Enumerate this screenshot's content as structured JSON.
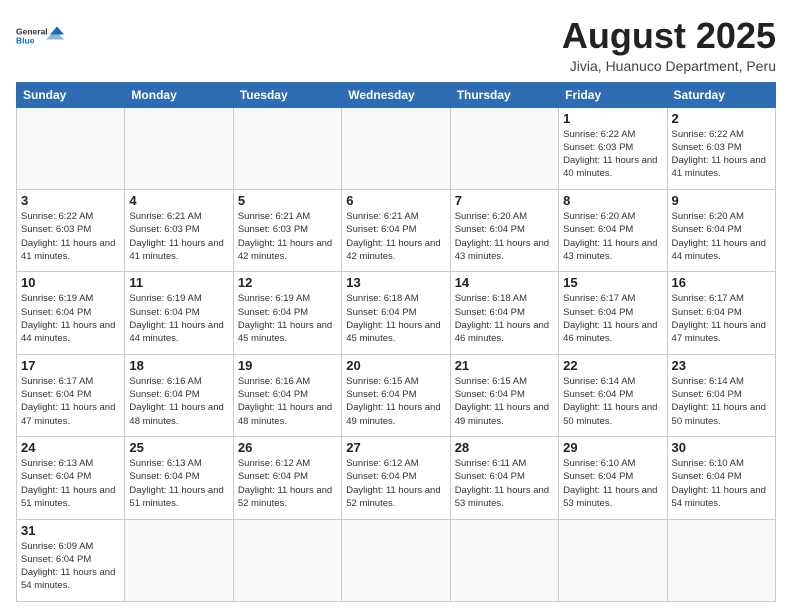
{
  "header": {
    "logo_general": "General",
    "logo_blue": "Blue",
    "title": "August 2025",
    "subtitle": "Jivia, Huanuco Department, Peru"
  },
  "calendar": {
    "days_of_week": [
      "Sunday",
      "Monday",
      "Tuesday",
      "Wednesday",
      "Thursday",
      "Friday",
      "Saturday"
    ],
    "weeks": [
      [
        {
          "day": "",
          "info": ""
        },
        {
          "day": "",
          "info": ""
        },
        {
          "day": "",
          "info": ""
        },
        {
          "day": "",
          "info": ""
        },
        {
          "day": "",
          "info": ""
        },
        {
          "day": "1",
          "info": "Sunrise: 6:22 AM\nSunset: 6:03 PM\nDaylight: 11 hours\nand 40 minutes."
        },
        {
          "day": "2",
          "info": "Sunrise: 6:22 AM\nSunset: 6:03 PM\nDaylight: 11 hours\nand 41 minutes."
        }
      ],
      [
        {
          "day": "3",
          "info": "Sunrise: 6:22 AM\nSunset: 6:03 PM\nDaylight: 11 hours\nand 41 minutes."
        },
        {
          "day": "4",
          "info": "Sunrise: 6:21 AM\nSunset: 6:03 PM\nDaylight: 11 hours\nand 41 minutes."
        },
        {
          "day": "5",
          "info": "Sunrise: 6:21 AM\nSunset: 6:03 PM\nDaylight: 11 hours\nand 42 minutes."
        },
        {
          "day": "6",
          "info": "Sunrise: 6:21 AM\nSunset: 6:04 PM\nDaylight: 11 hours\nand 42 minutes."
        },
        {
          "day": "7",
          "info": "Sunrise: 6:20 AM\nSunset: 6:04 PM\nDaylight: 11 hours\nand 43 minutes."
        },
        {
          "day": "8",
          "info": "Sunrise: 6:20 AM\nSunset: 6:04 PM\nDaylight: 11 hours\nand 43 minutes."
        },
        {
          "day": "9",
          "info": "Sunrise: 6:20 AM\nSunset: 6:04 PM\nDaylight: 11 hours\nand 44 minutes."
        }
      ],
      [
        {
          "day": "10",
          "info": "Sunrise: 6:19 AM\nSunset: 6:04 PM\nDaylight: 11 hours\nand 44 minutes."
        },
        {
          "day": "11",
          "info": "Sunrise: 6:19 AM\nSunset: 6:04 PM\nDaylight: 11 hours\nand 44 minutes."
        },
        {
          "day": "12",
          "info": "Sunrise: 6:19 AM\nSunset: 6:04 PM\nDaylight: 11 hours\nand 45 minutes."
        },
        {
          "day": "13",
          "info": "Sunrise: 6:18 AM\nSunset: 6:04 PM\nDaylight: 11 hours\nand 45 minutes."
        },
        {
          "day": "14",
          "info": "Sunrise: 6:18 AM\nSunset: 6:04 PM\nDaylight: 11 hours\nand 46 minutes."
        },
        {
          "day": "15",
          "info": "Sunrise: 6:17 AM\nSunset: 6:04 PM\nDaylight: 11 hours\nand 46 minutes."
        },
        {
          "day": "16",
          "info": "Sunrise: 6:17 AM\nSunset: 6:04 PM\nDaylight: 11 hours\nand 47 minutes."
        }
      ],
      [
        {
          "day": "17",
          "info": "Sunrise: 6:17 AM\nSunset: 6:04 PM\nDaylight: 11 hours\nand 47 minutes."
        },
        {
          "day": "18",
          "info": "Sunrise: 6:16 AM\nSunset: 6:04 PM\nDaylight: 11 hours\nand 48 minutes."
        },
        {
          "day": "19",
          "info": "Sunrise: 6:16 AM\nSunset: 6:04 PM\nDaylight: 11 hours\nand 48 minutes."
        },
        {
          "day": "20",
          "info": "Sunrise: 6:15 AM\nSunset: 6:04 PM\nDaylight: 11 hours\nand 49 minutes."
        },
        {
          "day": "21",
          "info": "Sunrise: 6:15 AM\nSunset: 6:04 PM\nDaylight: 11 hours\nand 49 minutes."
        },
        {
          "day": "22",
          "info": "Sunrise: 6:14 AM\nSunset: 6:04 PM\nDaylight: 11 hours\nand 50 minutes."
        },
        {
          "day": "23",
          "info": "Sunrise: 6:14 AM\nSunset: 6:04 PM\nDaylight: 11 hours\nand 50 minutes."
        }
      ],
      [
        {
          "day": "24",
          "info": "Sunrise: 6:13 AM\nSunset: 6:04 PM\nDaylight: 11 hours\nand 51 minutes."
        },
        {
          "day": "25",
          "info": "Sunrise: 6:13 AM\nSunset: 6:04 PM\nDaylight: 11 hours\nand 51 minutes."
        },
        {
          "day": "26",
          "info": "Sunrise: 6:12 AM\nSunset: 6:04 PM\nDaylight: 11 hours\nand 52 minutes."
        },
        {
          "day": "27",
          "info": "Sunrise: 6:12 AM\nSunset: 6:04 PM\nDaylight: 11 hours\nand 52 minutes."
        },
        {
          "day": "28",
          "info": "Sunrise: 6:11 AM\nSunset: 6:04 PM\nDaylight: 11 hours\nand 53 minutes."
        },
        {
          "day": "29",
          "info": "Sunrise: 6:10 AM\nSunset: 6:04 PM\nDaylight: 11 hours\nand 53 minutes."
        },
        {
          "day": "30",
          "info": "Sunrise: 6:10 AM\nSunset: 6:04 PM\nDaylight: 11 hours\nand 54 minutes."
        }
      ],
      [
        {
          "day": "31",
          "info": "Sunrise: 6:09 AM\nSunset: 6:04 PM\nDaylight: 11 hours\nand 54 minutes."
        },
        {
          "day": "",
          "info": ""
        },
        {
          "day": "",
          "info": ""
        },
        {
          "day": "",
          "info": ""
        },
        {
          "day": "",
          "info": ""
        },
        {
          "day": "",
          "info": ""
        },
        {
          "day": "",
          "info": ""
        }
      ]
    ]
  }
}
